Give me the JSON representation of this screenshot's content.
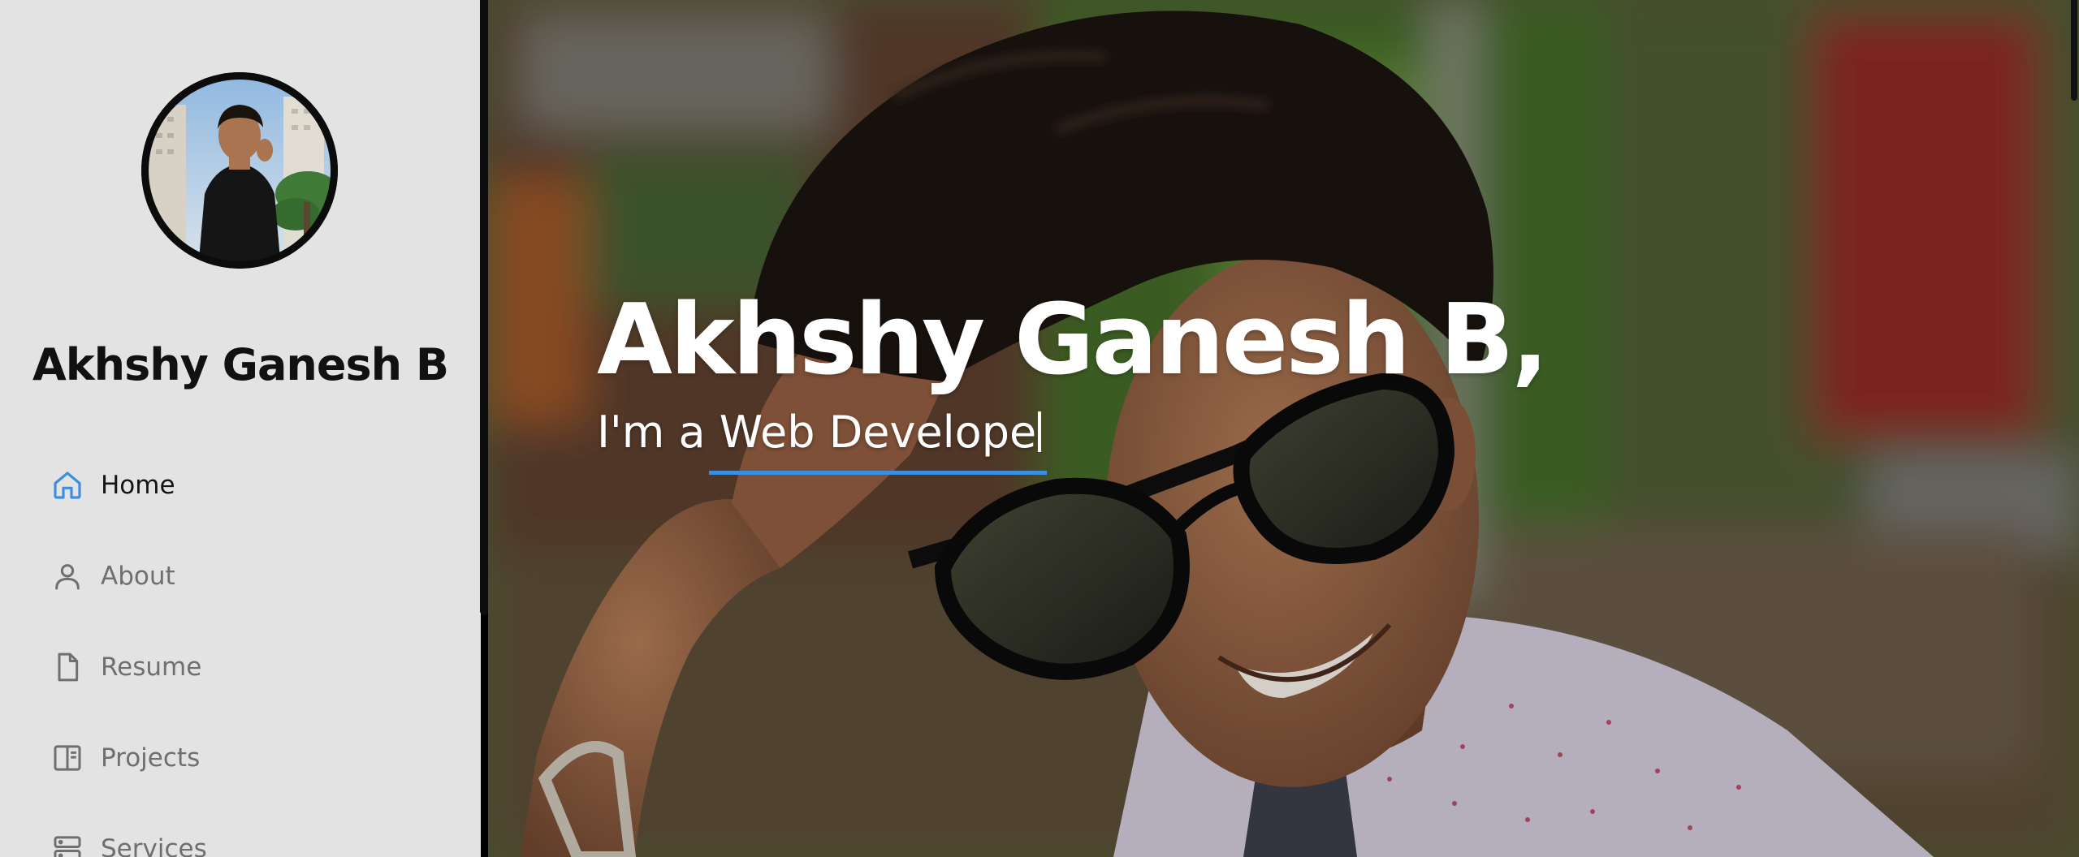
{
  "profile": {
    "name": "Akhshy Ganesh B"
  },
  "nav": {
    "items": [
      {
        "label": "Home",
        "icon": "home-icon",
        "active": true
      },
      {
        "label": "About",
        "icon": "person-icon",
        "active": false
      },
      {
        "label": "Resume",
        "icon": "file-icon",
        "active": false
      },
      {
        "label": "Projects",
        "icon": "layout-icon",
        "active": false
      },
      {
        "label": "Services",
        "icon": "server-icon",
        "active": false
      }
    ]
  },
  "hero": {
    "title": "Akhshy Ganesh B,",
    "subtitle": "I'm a Web Develope"
  },
  "colors": {
    "accent": "#3b8fe0",
    "sidebar_bg": "#e3e3e3",
    "nav_inactive": "#6f6f6f"
  }
}
